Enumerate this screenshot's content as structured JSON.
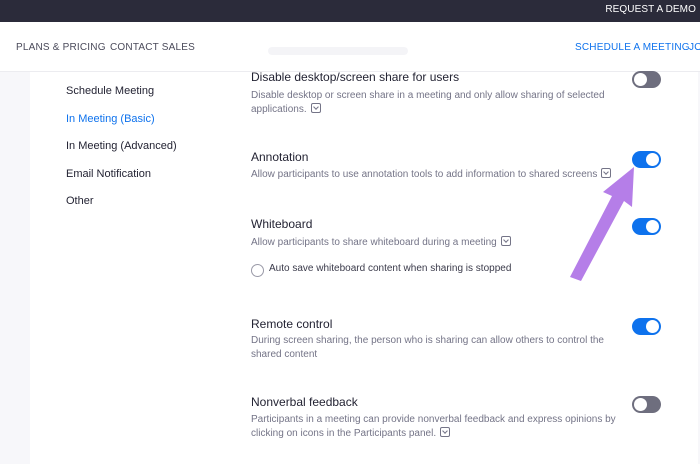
{
  "topbar": {
    "request_demo": "REQUEST A DEMO"
  },
  "nav": {
    "plans_pricing": "PLANS & PRICING",
    "contact_sales": "CONTACT SALES",
    "schedule_meeting": "SCHEDULE A MEETING",
    "join_partial": "JO"
  },
  "sidebar": {
    "items": [
      {
        "label": "Schedule Meeting"
      },
      {
        "label": "In Meeting (Basic)"
      },
      {
        "label": "In Meeting (Advanced)"
      },
      {
        "label": "Email Notification"
      },
      {
        "label": "Other"
      }
    ],
    "active_index": 1
  },
  "settings": [
    {
      "title": "Disable desktop/screen share for users",
      "description": "Disable desktop or screen share in a meeting and only allow sharing of selected applications.",
      "enabled": false
    },
    {
      "title": "Annotation",
      "description": "Allow participants to use annotation tools to add information to shared screens",
      "enabled": true
    },
    {
      "title": "Whiteboard",
      "description": "Allow participants to share whiteboard during a meeting",
      "enabled": true,
      "sub_option": {
        "label": "Auto save whiteboard content when sharing is stopped",
        "checked": false
      }
    },
    {
      "title": "Remote control",
      "description": "During screen sharing, the person who is sharing can allow others to control the shared content",
      "enabled": true
    },
    {
      "title": "Nonverbal feedback",
      "description": "Participants in a meeting can provide nonverbal feedback and express opinions by clicking on icons in the Participants panel.",
      "enabled": false
    }
  ],
  "colors": {
    "accent": "#0e72ed",
    "toggle_off": "#6e6e7e",
    "arrow": "#b57ee8",
    "topbar": "#2b2b3a"
  },
  "icons": [
    "info-icon",
    "toggle-switch",
    "annotation-arrow"
  ]
}
